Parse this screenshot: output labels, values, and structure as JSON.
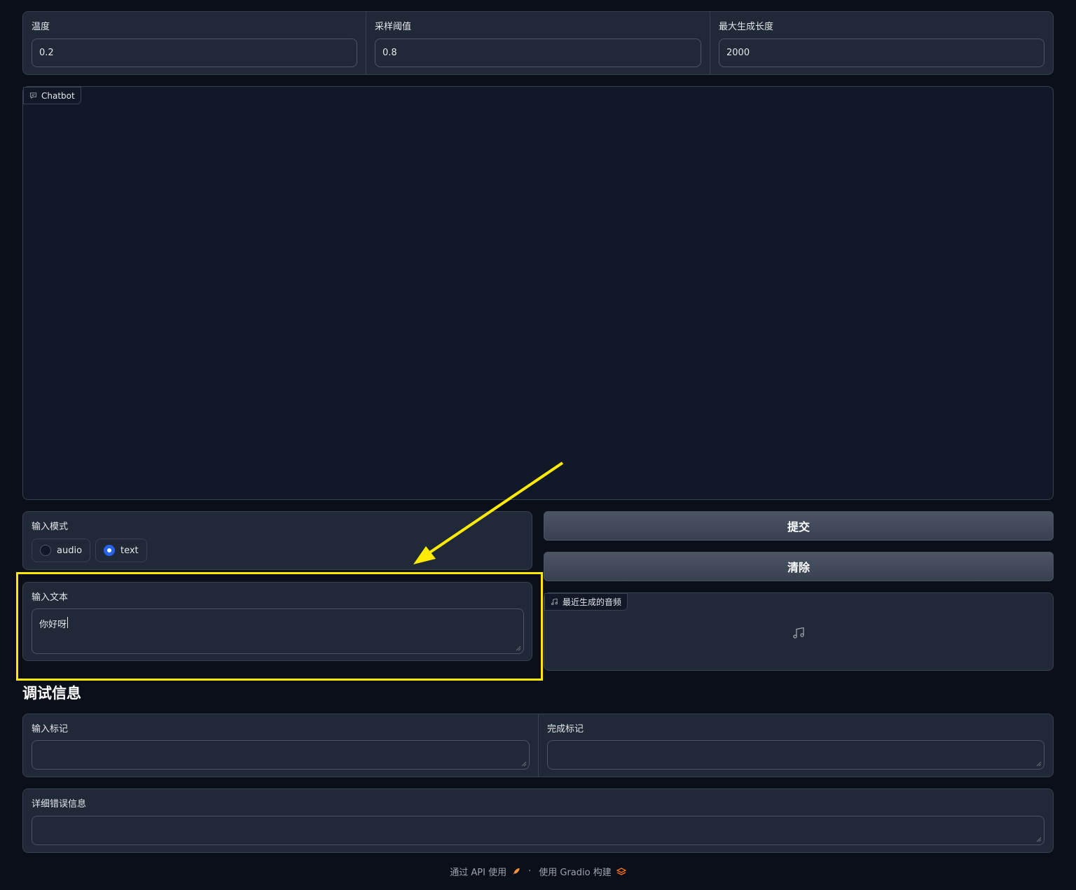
{
  "params": {
    "temperature": {
      "label": "温度",
      "value": "0.2"
    },
    "top_p": {
      "label": "采样阈值",
      "value": "0.8"
    },
    "max_length": {
      "label": "最大生成长度",
      "value": "2000"
    }
  },
  "chatbot": {
    "label": "Chatbot",
    "icon": "chat-icon"
  },
  "input_mode": {
    "label": "输入模式",
    "options": [
      "audio",
      "text"
    ],
    "selected": "text"
  },
  "input_text": {
    "label": "输入文本",
    "value": "你好呀"
  },
  "buttons": {
    "submit": "提交",
    "clear": "清除"
  },
  "audio": {
    "label": "最近生成的音频",
    "icon": "music-note-icon"
  },
  "debug": {
    "heading": "调试信息",
    "input_tokens": {
      "label": "输入标记",
      "value": ""
    },
    "completion_tokens": {
      "label": "完成标记",
      "value": ""
    },
    "error_detail": {
      "label": "详细错误信息",
      "value": ""
    }
  },
  "footer": {
    "api": "通过 API 使用",
    "sep": "·",
    "built": "使用 Gradio 构建"
  },
  "colors": {
    "highlight": "#ffeb00",
    "accent": "#2563eb",
    "background": "#0b0f19"
  }
}
